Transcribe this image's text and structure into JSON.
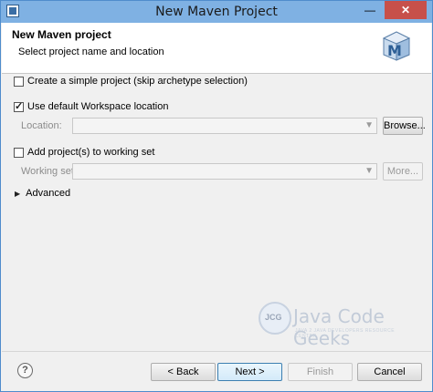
{
  "window": {
    "title": "New Maven Project",
    "minimize_glyph": "—",
    "close_glyph": "✕"
  },
  "banner": {
    "title": "New Maven project",
    "subtitle": "Select project name and location",
    "logo_letter": "M"
  },
  "options": {
    "simple_project_label": "Create a simple project (skip archetype selection)",
    "simple_project_checked": false,
    "default_workspace_label": "Use default Workspace location",
    "default_workspace_checked": true,
    "location_label": "Location:",
    "location_value": "",
    "browse_label": "Browse...",
    "working_set_check_label": "Add project(s) to working set",
    "working_set_checked": false,
    "working_set_label": "Working set:",
    "working_set_value": "",
    "more_label": "More...",
    "advanced_label": "Advanced"
  },
  "watermark": {
    "logo_text": "JCG",
    "title": "Java Code Geeks",
    "subtitle": "JAVA 2 JAVA DEVELOPERS RESOURCE CENTER"
  },
  "footer": {
    "help_glyph": "?",
    "back_label": "< Back",
    "next_label": "Next >",
    "finish_label": "Finish",
    "cancel_label": "Cancel"
  },
  "colors": {
    "title_bar": "#7fb1e3",
    "close_button": "#c7504a",
    "dialog_bg": "#f0f0f0"
  }
}
